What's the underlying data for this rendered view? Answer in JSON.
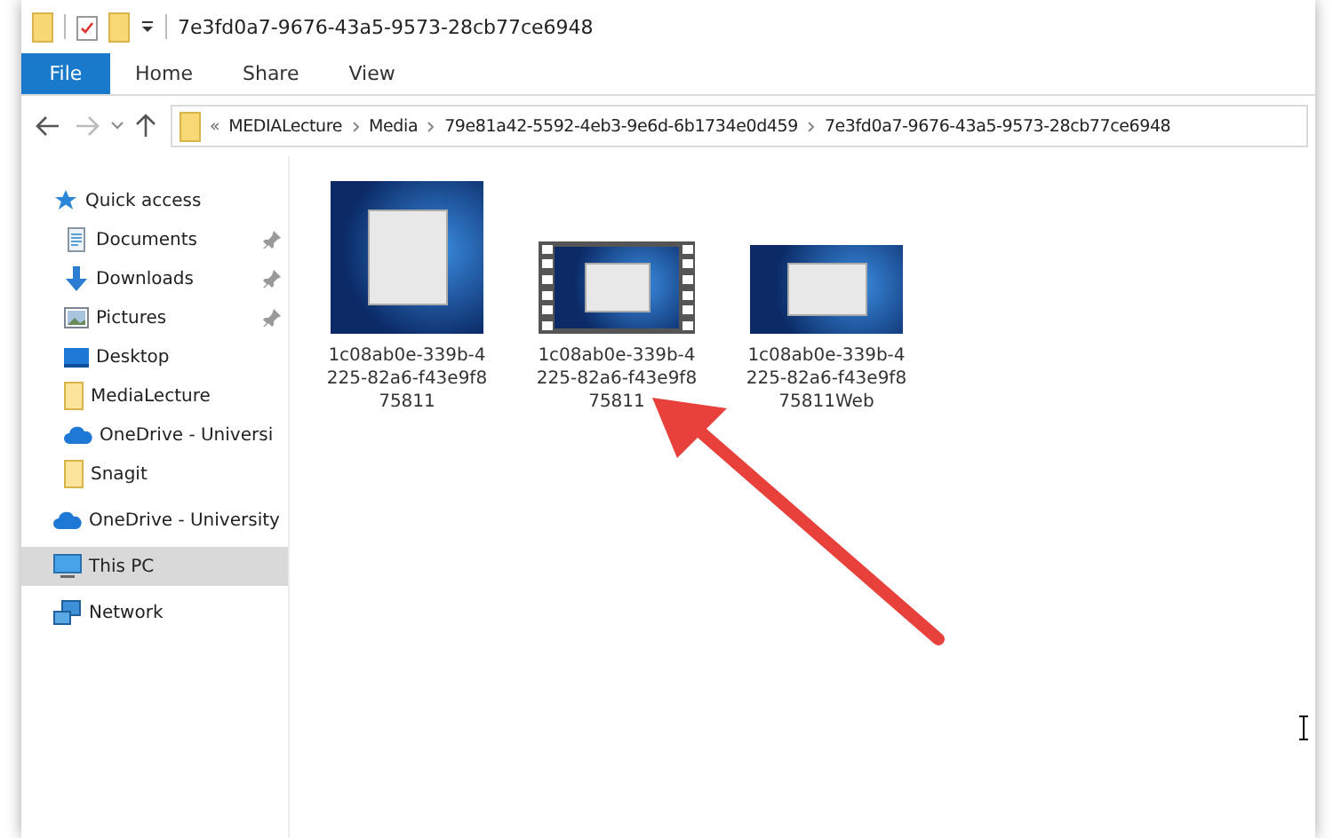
{
  "window": {
    "title": "7e3fd0a7-9676-43a5-9573-28cb77ce6948"
  },
  "ribbon_tabs": [
    {
      "label": "File",
      "selected": true
    },
    {
      "label": "Home",
      "selected": false
    },
    {
      "label": "Share",
      "selected": false
    },
    {
      "label": "View",
      "selected": false
    }
  ],
  "address_bar": {
    "overflow": "«",
    "segments": [
      "MEDIALecture",
      "Media",
      "79e81a42-5592-4eb3-9e6d-6b1734e0d459",
      "7e3fd0a7-9676-43a5-9573-28cb77ce6948"
    ]
  },
  "sidebar": {
    "items": [
      {
        "label": "Quick access",
        "kind": "star",
        "selected": false,
        "children": [
          {
            "label": "Documents",
            "kind": "documents",
            "pinned": true,
            "selected": false
          },
          {
            "label": "Downloads",
            "kind": "download",
            "pinned": true,
            "selected": false
          },
          {
            "label": "Pictures",
            "kind": "pictures",
            "pinned": true,
            "selected": false
          },
          {
            "label": "Desktop",
            "kind": "desktop",
            "pinned": false,
            "selected": false
          },
          {
            "label": "MediaLecture",
            "kind": "folder",
            "pinned": false,
            "selected": false
          },
          {
            "label": "OneDrive - Universi",
            "kind": "cloud",
            "pinned": false,
            "selected": false
          },
          {
            "label": "Snagit",
            "kind": "folder",
            "pinned": false,
            "selected": false
          }
        ]
      },
      {
        "label": "OneDrive - University",
        "kind": "cloud",
        "selected": false
      },
      {
        "label": "This PC",
        "kind": "pc",
        "selected": true
      },
      {
        "label": "Network",
        "kind": "network",
        "selected": false
      }
    ]
  },
  "files": [
    {
      "kind": "image",
      "name_lines": [
        "1c08ab0e-339b-4",
        "225-82a6-f43e9f8",
        "75811"
      ]
    },
    {
      "kind": "video",
      "name_lines": [
        "1c08ab0e-339b-4",
        "225-82a6-f43e9f8",
        "75811"
      ]
    },
    {
      "kind": "image_wide",
      "name_lines": [
        "1c08ab0e-339b-4",
        "225-82a6-f43e9f8",
        "75811Web"
      ]
    }
  ]
}
